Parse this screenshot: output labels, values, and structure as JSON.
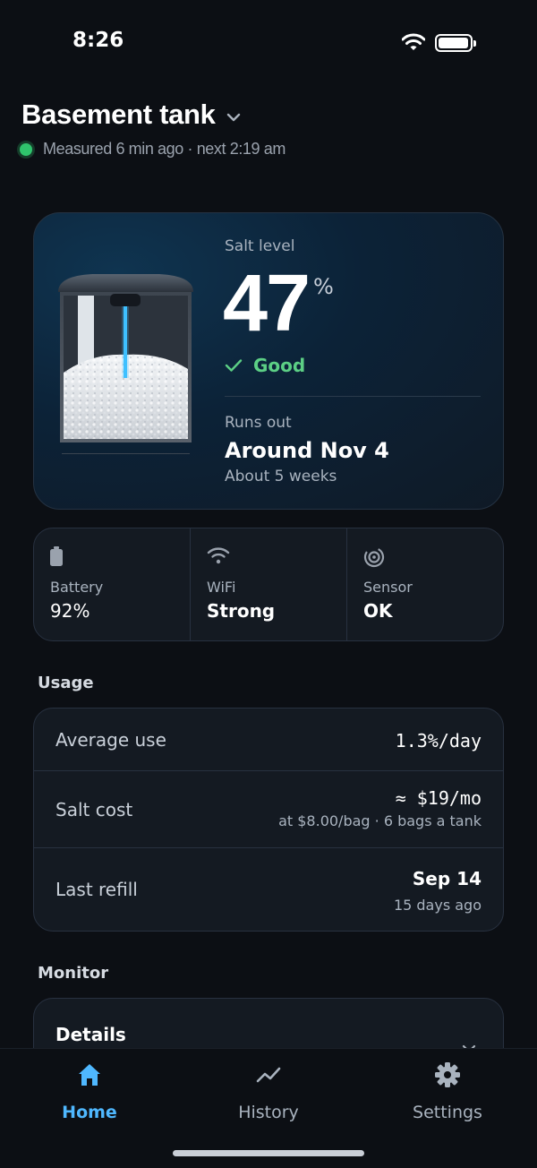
{
  "status_bar": {
    "time": "8:26"
  },
  "header": {
    "title": "Basement tank",
    "measured": "Measured 6 min ago · next 2:19 am",
    "status_color": "#2fc46c"
  },
  "hero": {
    "salt_label": "Salt level",
    "salt_value": "47",
    "salt_unit": "%",
    "salt_level_fraction": 0.47,
    "status": "Good",
    "runs_out_label": "Runs out",
    "runs_out_date": "Around Nov 4",
    "runs_out_weeks": "About 5 weeks"
  },
  "device": [
    {
      "icon": "battery-icon",
      "label": "Battery",
      "value": "92%"
    },
    {
      "icon": "wifi-icon",
      "label": "WiFi",
      "value": "Strong"
    },
    {
      "icon": "sensor-icon",
      "label": "Sensor",
      "value": "OK"
    }
  ],
  "usage": {
    "section_label": "Usage",
    "rows": [
      {
        "label": "Average use",
        "value": "1.3%/day",
        "sub": ""
      },
      {
        "label": "Salt cost",
        "value": "≈ $19/mo",
        "sub": "at $8.00/bag · 6 bags a tank"
      },
      {
        "label": "Last refill",
        "value": "Sep 14",
        "sub": "15 days ago"
      }
    ]
  },
  "monitor": {
    "section_label": "Monitor",
    "details_label": "Details"
  },
  "tabs": [
    {
      "label": "Home",
      "icon": "home-icon",
      "active": true
    },
    {
      "label": "History",
      "icon": "history-icon",
      "active": false
    },
    {
      "label": "Settings",
      "icon": "gear-icon",
      "active": false
    }
  ],
  "colors": {
    "accent": "#4fb8ff",
    "good": "#5ccf85",
    "background": "#0c0f14"
  }
}
